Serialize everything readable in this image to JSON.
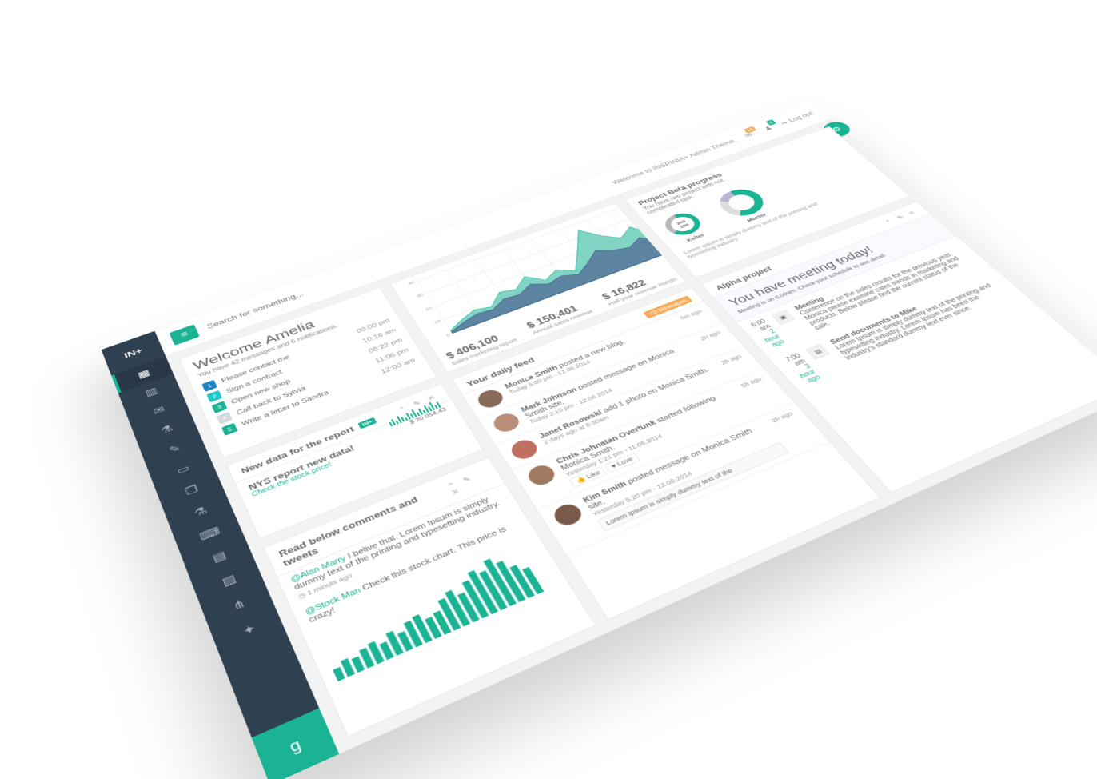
{
  "brand": "IN+",
  "topbar": {
    "search_placeholder": "Search for something...",
    "welcome": "Welcome to INSPINIA+ Admin Theme.",
    "mail_count": "16",
    "alert_count": "8",
    "logout": "Log out"
  },
  "welcome": {
    "title": "Welcome Amelia",
    "subtitle": "You have 42 messages and 6 notifications.",
    "todos": [
      {
        "n": "1",
        "text": "Please contact me",
        "time": "09:00 pm",
        "color": "#1c84c6"
      },
      {
        "n": "2",
        "text": "Sign a contract",
        "time": "10:16 am",
        "color": "#23c6c8"
      },
      {
        "n": "3",
        "text": "Open new shop",
        "time": "08:22 pm",
        "color": "#1ab394"
      },
      {
        "n": "4",
        "text": "Call back to Sylvia",
        "time": "11:06 pm",
        "color": "#d1dade"
      },
      {
        "n": "5",
        "text": "Write a letter to Sandra",
        "time": "12:00 am",
        "color": "#1ab394"
      }
    ]
  },
  "stats": [
    {
      "value": "$ 406,100",
      "label": "Sales marketing report"
    },
    {
      "value": "$ 150,401",
      "label": "Annual sales revenue"
    },
    {
      "value": "$ 16,822",
      "label": "Half-year revenue margin"
    }
  ],
  "chart_data": [
    {
      "type": "area",
      "title": "",
      "xlabel": "",
      "ylabel": "",
      "ylim": [
        0,
        40
      ],
      "yticks": [
        0,
        10,
        20,
        30,
        40
      ],
      "grid": true,
      "series": [
        {
          "values": [
            2,
            6,
            9,
            7,
            14,
            12,
            18,
            11,
            15,
            10,
            22,
            35,
            26,
            20,
            25,
            15,
            17,
            22,
            18,
            14
          ],
          "color": "#1ab394"
        },
        {
          "values": [
            1,
            4,
            6,
            5,
            9,
            8,
            12,
            8,
            10,
            7,
            12,
            18,
            14,
            12,
            16,
            10,
            11,
            17,
            13,
            10
          ],
          "color": "#464f88"
        }
      ]
    },
    {
      "type": "pie",
      "title": "Kolter",
      "labels": [
        "300",
        "150"
      ],
      "values": [
        300,
        150
      ]
    },
    {
      "type": "pie",
      "title": "Maxtor",
      "values": [
        60,
        25,
        15
      ]
    },
    {
      "type": "bar",
      "title": "",
      "values": [
        5,
        7,
        6,
        8,
        9,
        7,
        10,
        8,
        11,
        12,
        9,
        10,
        14,
        16,
        13,
        17,
        20,
        18,
        22,
        19,
        15,
        12
      ]
    }
  ],
  "beta": {
    "title": "Project Beta progress",
    "subtitle": "You have two project with not compleated task.",
    "kolter": "Kolter",
    "maxtor": "Maxtor",
    "foot": "Lorem Ipsum is simply dummy text of the printing and typesetting industry."
  },
  "newdata": {
    "title": "New data for the report",
    "label": "IN+",
    "heading": "NYS report new data!",
    "link": "Check the stock price!",
    "amount": "$ 20 054.43"
  },
  "feed": {
    "title": "Your daily feed",
    "badge": "10 Messages",
    "items": [
      {
        "name": "Monica Smith",
        "rest": "posted a new blog.",
        "meta": "Today 5:60 pm - 12.06.2014",
        "ago": "5m ago",
        "color": "#8a6a5a"
      },
      {
        "name": "Mark Johnson",
        "rest": "posted message on Monica Smith site.",
        "meta": "Today 2:10 pm - 12.06.2014",
        "ago": "2h ago",
        "color": "#b98f7a"
      },
      {
        "name": "Janet Rosowski",
        "rest": "add 1 photo on Monica Smith.",
        "meta": "2 days ago at 8:30am",
        "ago": "2h ago",
        "color": "#c07060"
      },
      {
        "name": "Chris Johnatan Overtunk",
        "rest": "started following Monica Smith.",
        "meta": "Yesterday 1:21 pm - 11.06.2014",
        "ago": "5h ago",
        "color": "#a07a60"
      },
      {
        "name": "Kim Smith",
        "rest": "posted message on Monica Smith site.",
        "meta": "Yesterday 5:20 pm - 12.06.2014",
        "ago": "2h ago",
        "color": "#7a5a4a"
      }
    ],
    "like": "Like",
    "love": "Love",
    "quote": "Lorem Ipsum is simply dummy text of the"
  },
  "alpha": {
    "title": "Alpha project",
    "hero": "You have meeting today!",
    "hero_sub": "Meeting is on 6:00am. Check your schedule to see detail.",
    "events": [
      {
        "time": "6:00 am",
        "ago": "2 hour ago",
        "title": "Meeting",
        "desc": "Conference on the sales results for the previous year. Monica please examine sales trends in marketing and products. Below please find the current status of the sale."
      },
      {
        "time": "7:00 am",
        "ago": "3 hour ago",
        "title": "Send documents to Mike",
        "desc": "Lorem Ipsum is simply dummy text of the printing and typesetting industry. Lorem Ipsum has been the industry's standard dummy text ever since."
      }
    ]
  },
  "comments": {
    "title": "Read below comments and tweets",
    "items": [
      {
        "mention": "@Alan Marry",
        "text": "I belive that. Lorem Ipsum is simply dummy text of the printing and typesetting industry.",
        "meta": "1 minuts ago"
      },
      {
        "mention": "@Stock Man",
        "text": "Check this stock chart. This price is crazy!",
        "meta": ""
      }
    ]
  },
  "colors": {
    "accent": "#1ab394",
    "sidebar": "#2f4050",
    "warning": "#f8ac59"
  }
}
